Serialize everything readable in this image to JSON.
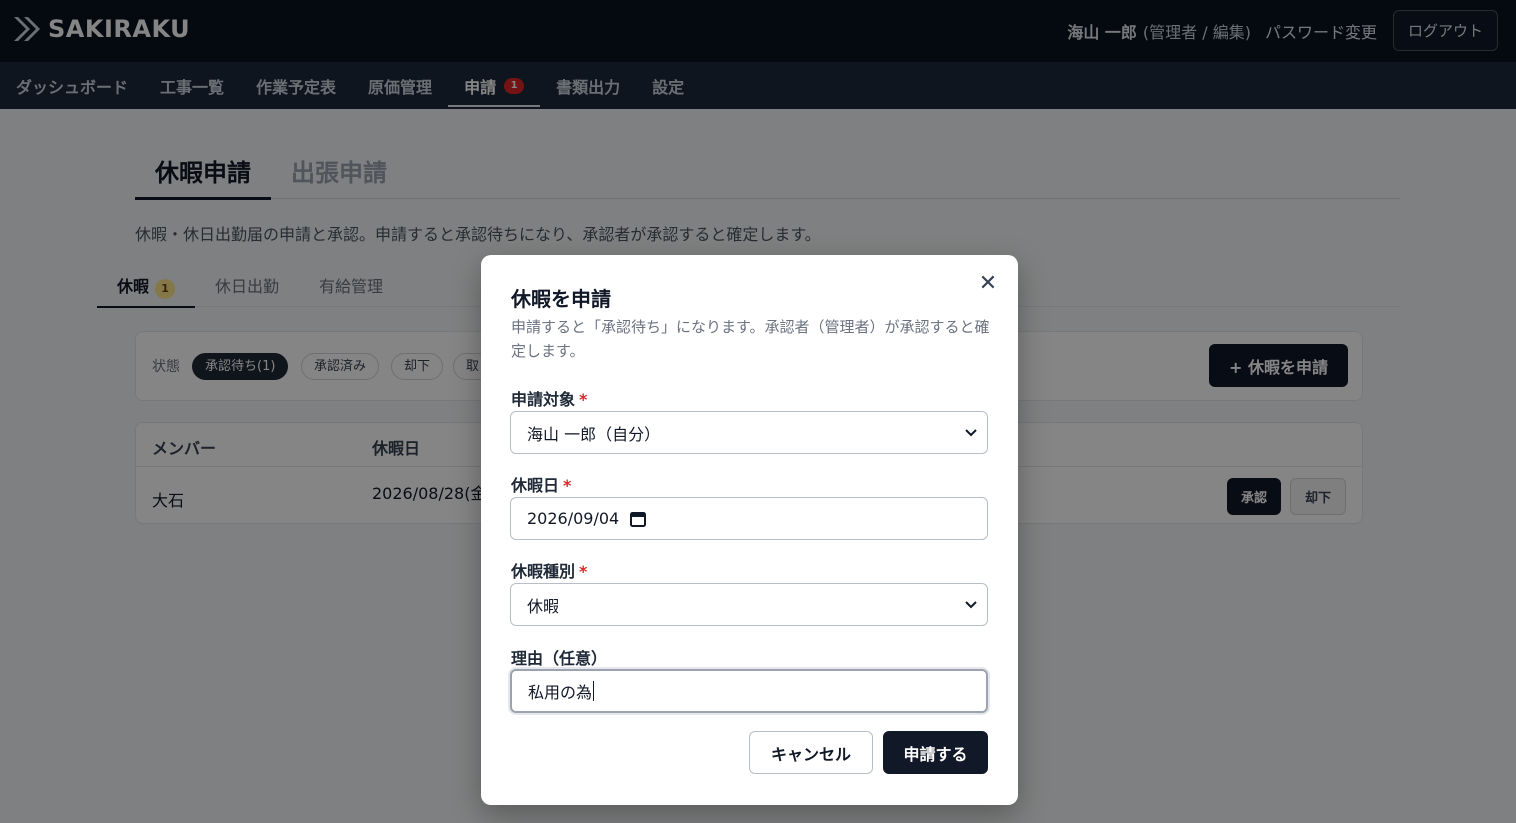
{
  "header": {
    "logo_text": "SAKIRAKU",
    "user_name": "海山 一郎",
    "user_role": "(管理者 / 編集)",
    "password_link": "パスワード変更",
    "logout_label": "ログアウト"
  },
  "nav": {
    "items": [
      {
        "label": "ダッシュボード"
      },
      {
        "label": "工事一覧"
      },
      {
        "label": "作業予定表"
      },
      {
        "label": "原価管理"
      },
      {
        "label": "申請",
        "badge": "1"
      },
      {
        "label": "書類出力"
      },
      {
        "label": "設定"
      }
    ],
    "active_index": 4
  },
  "page": {
    "tabs": [
      {
        "label": "休暇申請"
      },
      {
        "label": "出張申請"
      }
    ],
    "description": "休暇・休日出勤届の申請と承認。申請すると承認待ちになり、承認者が承認すると確定します。",
    "sub_tabs": [
      {
        "label": "休暇",
        "badge": "1"
      },
      {
        "label": "休日出勤"
      },
      {
        "label": "有給管理"
      }
    ],
    "filter": {
      "label": "状態",
      "chips": [
        "承認待ち(1)",
        "承認済み",
        "却下",
        "取"
      ]
    },
    "apply_button": "+ 休暇を申請",
    "table": {
      "headers": [
        "メンバー",
        "休暇日"
      ],
      "rows": [
        {
          "member": "大石",
          "date": "2026/08/28(金",
          "approve": "承認",
          "reject": "却下"
        }
      ]
    }
  },
  "modal": {
    "title": "休暇を申請",
    "description": "申請すると「承認待ち」になります。承認者（管理者）が承認すると確定します。",
    "fields": {
      "target": {
        "label": "申請対象",
        "required": "*",
        "value": "海山 一郎（自分）"
      },
      "date": {
        "label": "休暇日",
        "required": "*",
        "value": "2026/09/04"
      },
      "type": {
        "label": "休暇種別",
        "required": "*",
        "value": "休暇"
      },
      "reason": {
        "label": "理由（任意）",
        "value": "私用の為"
      }
    },
    "cancel_label": "キャンセル",
    "submit_label": "申請する",
    "close_icon": "close-icon"
  }
}
